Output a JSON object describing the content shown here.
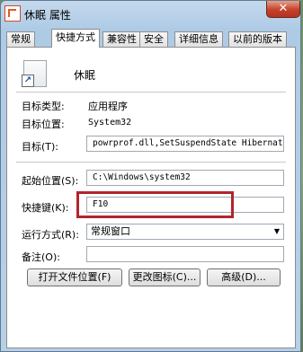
{
  "window": {
    "title": "休眠 属性",
    "close_glyph": "✕"
  },
  "tabs": [
    {
      "label": "常规",
      "active": false
    },
    {
      "label": "快捷方式",
      "active": true
    },
    {
      "label": "兼容性",
      "active": false
    },
    {
      "label": "安全",
      "active": false
    },
    {
      "label": "详细信息",
      "active": false
    },
    {
      "label": "以前的版本",
      "active": false
    }
  ],
  "shortcut": {
    "name": "休眠",
    "target_type_label": "目标类型:",
    "target_type_value": "应用程序",
    "target_location_label": "目标位置:",
    "target_location_value": "System32",
    "target_label": "目标(T):",
    "target_value": "powrprof.dll,SetSuspendState Hibernate",
    "start_in_label": "起始位置(S):",
    "start_in_value": "C:\\Windows\\system32",
    "hotkey_label": "快捷键(K):",
    "hotkey_value": "F10",
    "run_label": "运行方式(R):",
    "run_value": "常规窗口",
    "comment_label": "备注(O):",
    "comment_value": ""
  },
  "buttons": {
    "open_location": "打开文件位置(F)",
    "change_icon": "更改图标(C)...",
    "advanced": "高级(D)..."
  },
  "colors": {
    "highlight_box": "#b1262c",
    "close_button": "#c4412a"
  }
}
